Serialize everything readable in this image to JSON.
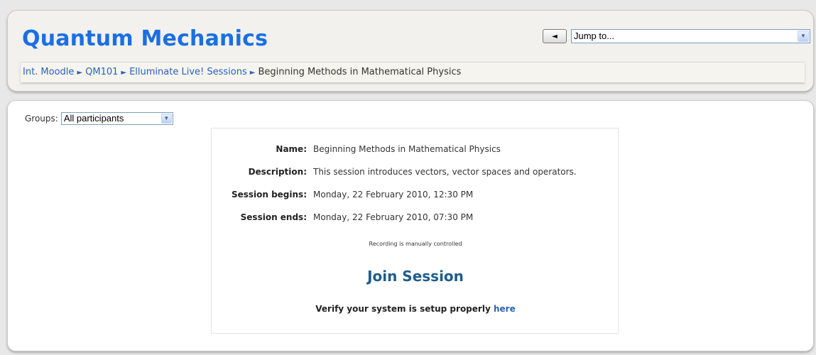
{
  "header": {
    "title": "Quantum Mechanics",
    "jump_back_glyph": "◄",
    "jump_select_value": "Jump to..."
  },
  "breadcrumb": [
    {
      "label": "Int. Moodle",
      "link": true
    },
    {
      "label": "QM101",
      "link": true
    },
    {
      "label": "Elluminate Live! Sessions",
      "link": true
    },
    {
      "label": "Beginning Methods in Mathematical Physics",
      "link": false
    }
  ],
  "breadcrumb_separator": "►",
  "groups": {
    "label": "Groups:",
    "selected": "All participants"
  },
  "session": {
    "name_label": "Name:",
    "name": "Beginning Methods in Mathematical Physics",
    "description_label": "Description:",
    "description": "This session introduces vectors, vector spaces and operators.",
    "begins_label": "Session begins:",
    "begins": "Monday, 22 February 2010, 12:30 PM",
    "ends_label": "Session ends:",
    "ends": "Monday, 22 February 2010, 07:30 PM",
    "recording_note": "Recording is manually controlled",
    "join_label": "Join Session",
    "verify_text": "Verify your system is setup properly",
    "verify_link": "here"
  },
  "colors": {
    "title": "#1a6fe3",
    "link": "#2a62b9",
    "join": "#1f5c8b"
  }
}
